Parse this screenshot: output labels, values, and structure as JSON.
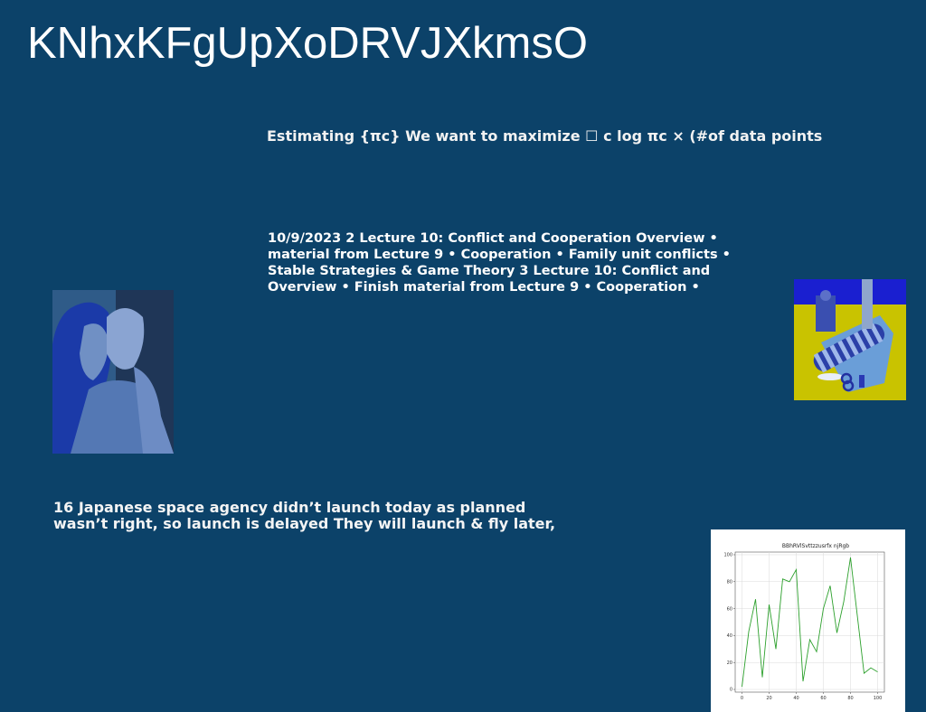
{
  "slide": {
    "title": "KNhxKFgUpXoDRVJXkmsO",
    "subtitle": "Estimating {πc} We want to maximize ☐ c log πc × (#of data points",
    "lecture_lines": [
      "10/9/2023 2 Lecture 10: Conflict and Cooperation Overview •",
      "material from Lecture 9 • Cooperation • Family unit conflicts •",
      "Stable Strategies & Game Theory 3 Lecture 10: Conflict and",
      "Overview • Finish material from Lecture 9 • Cooperation •"
    ],
    "news_lines": [
      "16 Japanese space agency didn’t launch today as planned",
      "wasn’t right, so launch is delayed They will launch & fly later,"
    ]
  },
  "images": {
    "left_photo": "couple-portrait-photo",
    "right_photo": "gift-wrapping-photo"
  },
  "colors": {
    "background": "#0c4269",
    "line": "#2ca02c"
  },
  "chart_data": {
    "type": "line",
    "title": "BBhRVlSvttzzusrfx njRgb",
    "xlabel": "",
    "ylabel": "",
    "xlim": [
      -5,
      105
    ],
    "ylim": [
      -2,
      102
    ],
    "grid": true,
    "x_ticks": [
      "0",
      "20",
      "40",
      "60",
      "80",
      "100"
    ],
    "y_ticks": [
      "0",
      "20",
      "40",
      "60",
      "80",
      "100"
    ],
    "series": [
      {
        "x": [
          0,
          5,
          10,
          15,
          20,
          25,
          30,
          35,
          40,
          45,
          50,
          55,
          60,
          65,
          70,
          75,
          80,
          85,
          90,
          95,
          100
        ],
        "values": [
          2,
          43,
          67,
          9,
          63,
          30,
          82,
          80,
          89,
          6,
          37,
          28,
          60,
          77,
          42,
          65,
          98,
          55,
          12,
          16,
          13
        ]
      }
    ]
  }
}
